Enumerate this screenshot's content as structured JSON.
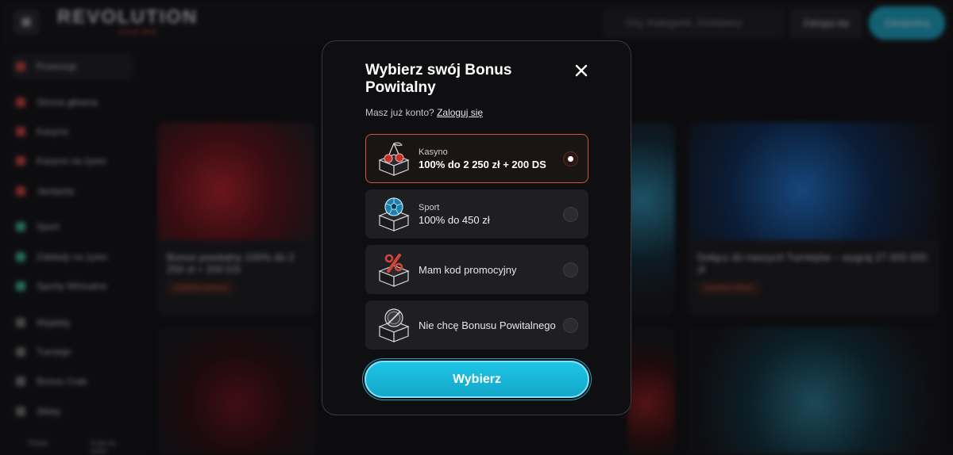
{
  "background": {
    "logo": "REVOLUTION",
    "logo_sub": "CASINO",
    "search_placeholder": "Gry, Kategorie, Dostawcy",
    "login_label": "Zaloguj się",
    "register_label": "Zarejestruj",
    "sidebar": [
      "Promocje",
      "Strona główna",
      "Kasyno",
      "Kasyno na żywo",
      "Jackpoty",
      "Sport",
      "Zakłady na żywo",
      "Sporty Wirtualne",
      "Wypłaty",
      "Turnieje",
      "Bonus Crab",
      "Sklep"
    ],
    "cards": [
      {
        "title": "Bonus powitalny 100% do 2 250 zł + 200 DS",
        "tag": "ODBIERZ BONUS"
      },
      {
        "title": "Dołącz do naszych Turniejów – wygraj 27 000 000 zł",
        "tag": "ZAGRAJ TERAZ"
      }
    ],
    "bottom_left": "Polski",
    "bottom_right": "Czat na żywo"
  },
  "modal": {
    "title": "Wybierz swój Bonus Powitalny",
    "account_prompt": "Masz już konto?",
    "account_link": "Zaloguj się",
    "options": [
      {
        "label": "Kasyno",
        "value": "100% do 2 250 zł + 200 DS",
        "selected": true,
        "icon": "cherries-box-icon"
      },
      {
        "label": "Sport",
        "value": "100% do 450 zł",
        "selected": false,
        "icon": "football-box-icon"
      },
      {
        "label": "Mam kod promocyjny",
        "selected": false,
        "icon": "percent-box-icon"
      },
      {
        "label": "Nie chcę Bonusu Powitalnego",
        "selected": false,
        "icon": "crossed-coin-box-icon"
      }
    ],
    "submit_label": "Wybierz"
  },
  "colors": {
    "accent": "#1ec4e6",
    "selected_border": "#d0523f",
    "modal_bg": "#0f0f11"
  }
}
